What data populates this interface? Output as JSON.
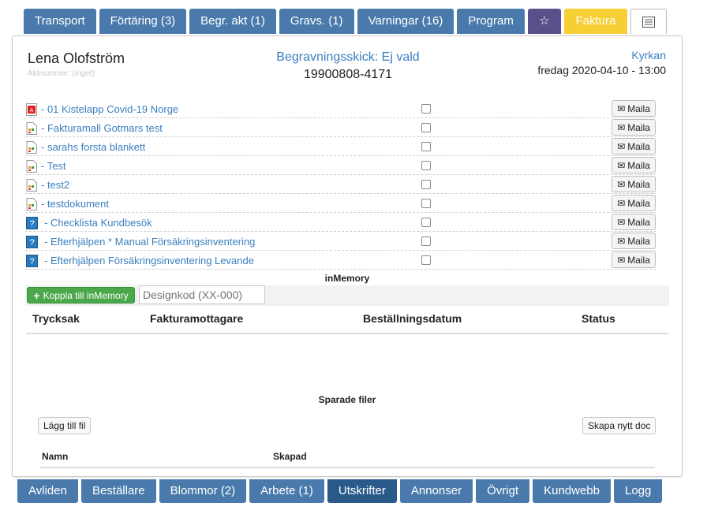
{
  "top_tabs": [
    {
      "label": "Transport"
    },
    {
      "label": "Förtäring (3)"
    },
    {
      "label": "Begr. akt (1)"
    },
    {
      "label": "Gravs. (1)"
    },
    {
      "label": "Varningar (16)"
    },
    {
      "label": "Program"
    },
    {
      "label": "☆",
      "icon": "star-icon"
    },
    {
      "label": "Faktura",
      "color": "#f6cf35"
    },
    {
      "label": "",
      "icon": "list-icon"
    }
  ],
  "header": {
    "name": "Lena Olofström",
    "aktnummer": "Aktnummer: (inget)",
    "begravningsskick": "Begravningsskick: Ej vald",
    "personnummer": "19900808-4171",
    "location": "Kyrkan",
    "datetime": "fredag 2020-04-10 - 13:00"
  },
  "documents": [
    {
      "icon": "pdf-icon",
      "label": "- 01 Kistelapp Covid-19 Norge",
      "mail": "Maila"
    },
    {
      "icon": "doc-icon",
      "label": "- Fakturamall Gotmars test",
      "mail": "Maila"
    },
    {
      "icon": "doc-icon",
      "label": "- sarahs forsta blankett",
      "mail": "Maila"
    },
    {
      "icon": "doc-icon",
      "label": "- Test",
      "mail": "Maila"
    },
    {
      "icon": "doc-icon",
      "label": "- test2",
      "mail": "Maila"
    },
    {
      "icon": "doc-icon",
      "label": "- testdokument",
      "mail": "Maila"
    },
    {
      "icon": "question-icon",
      "label": "- Checklista Kundbesök",
      "mail": "Maila"
    },
    {
      "icon": "question-icon",
      "label": "- Efterhjälpen * Manual Försäkringsinventering",
      "mail": "Maila"
    },
    {
      "icon": "question-icon",
      "label": "- Efterhjälpen Försäkringsinventering Levande",
      "mail": "Maila"
    }
  ],
  "inmemory": {
    "title": "inMemory",
    "connect_button": "Koppla till inMemory",
    "designkod_placeholder": "Designkod (XX-000)",
    "columns": [
      "Trycksak",
      "Fakturamottagare",
      "Beställningsdatum",
      "Status"
    ]
  },
  "saved_files": {
    "title": "Sparade filer",
    "add_button": "Lägg till fil",
    "new_doc_button": "Skapa nytt doc",
    "columns": [
      "Namn",
      "Skapad"
    ]
  },
  "bottom_tabs": [
    {
      "label": "Avliden"
    },
    {
      "label": "Beställare"
    },
    {
      "label": "Blommor (2)"
    },
    {
      "label": "Arbete (1)"
    },
    {
      "label": "Utskrifter",
      "active": true
    },
    {
      "label": "Annonser"
    },
    {
      "label": "Övrigt"
    },
    {
      "label": "Kundwebb"
    },
    {
      "label": "Logg"
    }
  ],
  "colors": {
    "tab": "#4a7aab",
    "active_tab": "#2a5a8a",
    "star_tab": "#5a4f8a",
    "link": "#3a7fbf",
    "green": "#4aa84a"
  }
}
